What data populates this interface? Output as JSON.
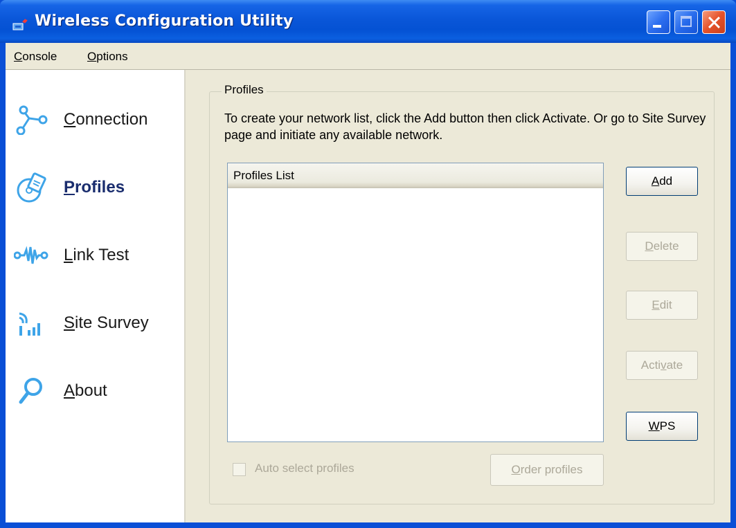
{
  "window": {
    "title": "Wireless Configuration Utility",
    "icon": "wireless-app-icon",
    "controls": [
      "minimize-icon",
      "maximize-icon",
      "close-icon"
    ]
  },
  "menu": {
    "console_label": "Console",
    "options_label": "Options"
  },
  "sidebar": {
    "items": [
      {
        "label": "Connection",
        "icon": "connection-icon",
        "active": false
      },
      {
        "label": "Profiles",
        "icon": "profiles-icon",
        "active": true
      },
      {
        "label": "Link Test",
        "icon": "link-test-icon",
        "active": false
      },
      {
        "label": "Site Survey",
        "icon": "site-survey-icon",
        "active": false
      },
      {
        "label": "About",
        "icon": "about-search-icon",
        "active": false
      }
    ]
  },
  "profiles_panel": {
    "group_title": "Profiles",
    "instructions": "To create your network list, click the Add button then click Activate. Or go to Site Survey page and initiate any available network.",
    "list_header": "Profiles List",
    "list_items": [],
    "buttons": {
      "add": "Add",
      "delete": "Delete",
      "edit": "Edit",
      "activate": "Activate",
      "wps": "WPS",
      "order_profiles": "Order profiles"
    },
    "auto_select_label": "Auto select profiles",
    "auto_select_checked": false
  },
  "colors": {
    "title_bar": "#0a56d8",
    "window_bg": "#ece9d8",
    "icon_blue": "#3ea4e8",
    "disabled_text": "#aca899"
  }
}
